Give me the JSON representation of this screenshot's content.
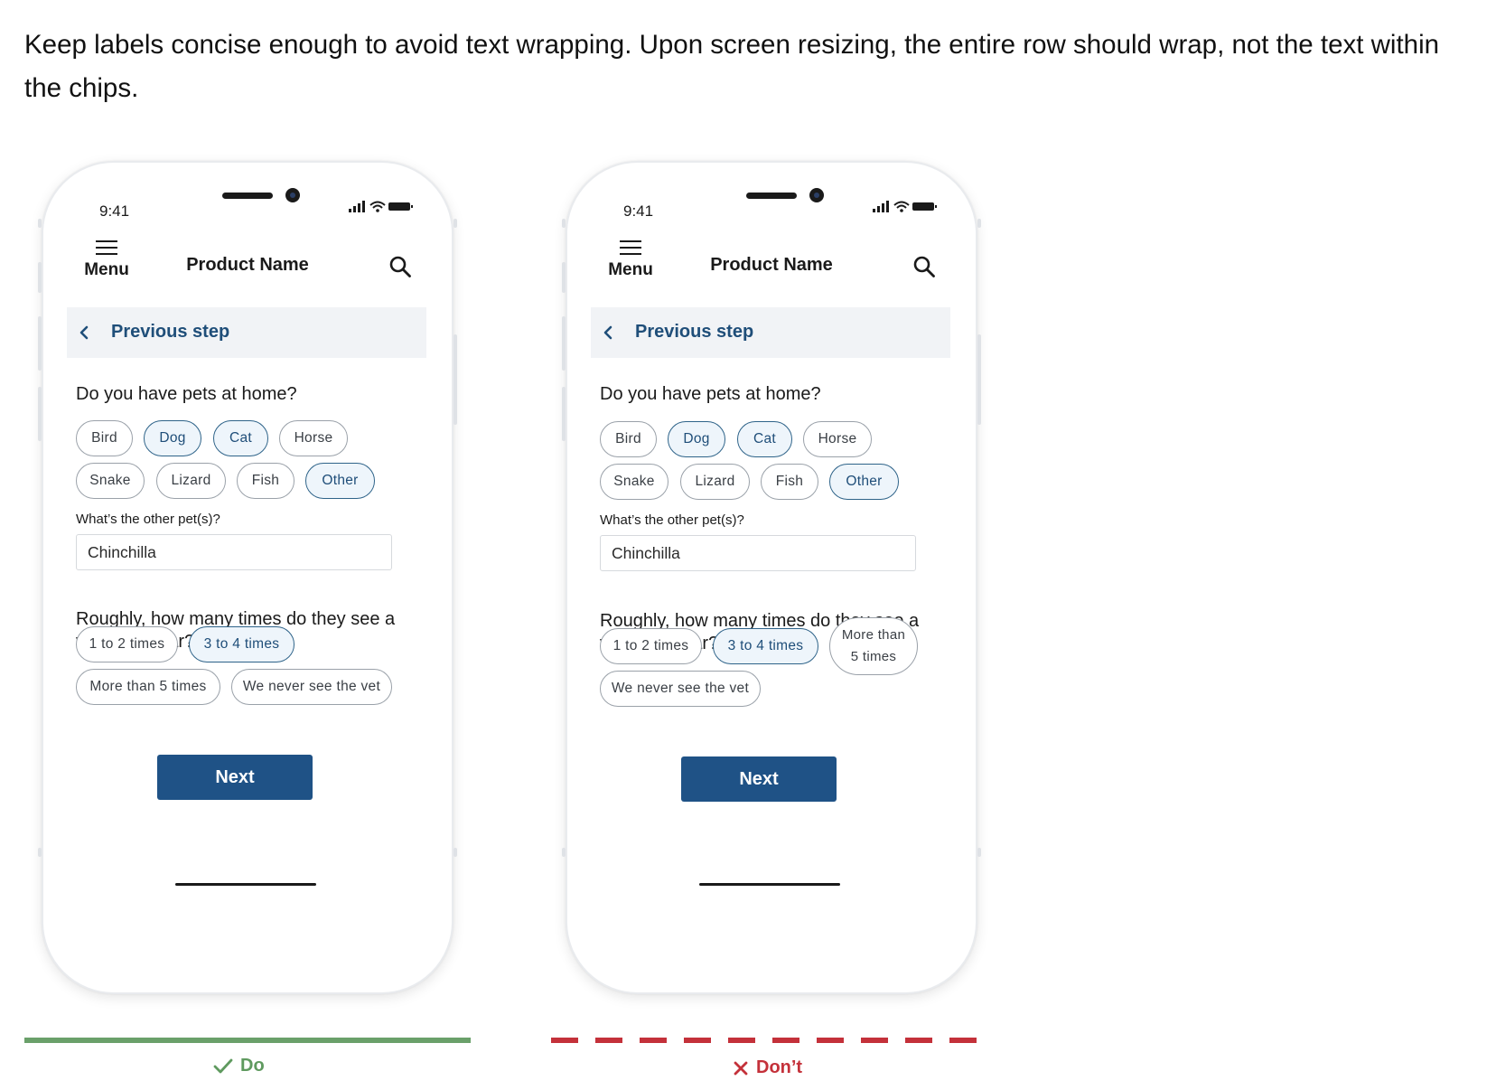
{
  "intro_text": "Keep labels concise enough to avoid text wrapping. Upon screen resizing, the entire row should wrap, not the text within the chips.",
  "colors": {
    "accent": "#1f5286",
    "selected_border": "#2e6389",
    "do": "#6aa06a",
    "dont": "#c4313a"
  },
  "examples": [
    {
      "time": "9:41",
      "menu_label": "Menu",
      "product_name": "Product Name",
      "previous_step": "Previous step",
      "question1": "Do you have pets at home?",
      "pets": [
        {
          "label": "Bird",
          "selected": false
        },
        {
          "label": "Dog",
          "selected": true
        },
        {
          "label": "Cat",
          "selected": true
        },
        {
          "label": "Horse",
          "selected": false
        },
        {
          "label": "Snake",
          "selected": false
        },
        {
          "label": "Lizard",
          "selected": false
        },
        {
          "label": "Fish",
          "selected": false
        },
        {
          "label": "Other",
          "selected": true
        }
      ],
      "other_label": "What’s the other pet(s)?",
      "other_value": "Chinchilla",
      "question2": "Roughly, how many times do they see a vet each year?",
      "visits": [
        {
          "label": "1 to 2 times",
          "selected": false
        },
        {
          "label": "3 to 4 times",
          "selected": true
        },
        {
          "label": "More than 5 times",
          "selected": false
        },
        {
          "label": "We never see the vet",
          "selected": false
        }
      ],
      "next_label": "Next",
      "verdict": "Do"
    },
    {
      "time": "9:41",
      "menu_label": "Menu",
      "product_name": "Product Name",
      "previous_step": "Previous step",
      "question1": "Do you have pets at home?",
      "pets": [
        {
          "label": "Bird",
          "selected": false
        },
        {
          "label": "Dog",
          "selected": true
        },
        {
          "label": "Cat",
          "selected": true
        },
        {
          "label": "Horse",
          "selected": false
        },
        {
          "label": "Snake",
          "selected": false
        },
        {
          "label": "Lizard",
          "selected": false
        },
        {
          "label": "Fish",
          "selected": false
        },
        {
          "label": "Other",
          "selected": true
        }
      ],
      "other_label": "What’s the other pet(s)?",
      "other_value": "Chinchilla",
      "question2": "Roughly, how many times do they see a vet each year?",
      "visits": [
        {
          "label": "1 to 2 times",
          "selected": false
        },
        {
          "label": "3 to 4 times",
          "selected": true
        },
        {
          "label": "More than 5 times",
          "selected": false
        },
        {
          "label": "We never see the vet",
          "selected": false
        }
      ],
      "next_label": "Next",
      "verdict": "Don’t"
    }
  ]
}
